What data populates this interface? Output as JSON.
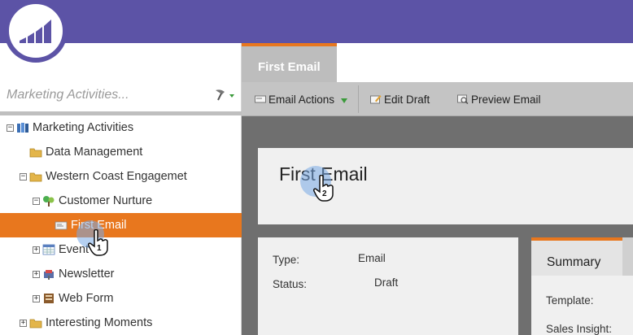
{
  "header": {
    "brand": "Marketo",
    "logo_icon": "marketo-logo-icon",
    "bar_color": "#5c53a6"
  },
  "search": {
    "placeholder": "Marketing Activities...",
    "filter_icon": "filter-icon"
  },
  "tree": [
    {
      "label": "Marketing Activities",
      "icon": "marketing-activities-icon",
      "expander": "−"
    },
    {
      "label": "Data Management",
      "icon": "folder-icon",
      "expander": ""
    },
    {
      "label": "Western Coast Engagemet",
      "icon": "folder-icon",
      "expander": "−"
    },
    {
      "label": "Customer Nurture",
      "icon": "program-icon",
      "expander": "−"
    },
    {
      "label": "First Email",
      "icon": "email-icon",
      "expander": "",
      "selected": true
    },
    {
      "label": "Event",
      "icon": "event-icon",
      "expander": "+"
    },
    {
      "label": "Newsletter",
      "icon": "newsletter-icon",
      "expander": "+"
    },
    {
      "label": "Web Form",
      "icon": "web-form-icon",
      "expander": "+"
    },
    {
      "label": "Interesting Moments",
      "icon": "folder-icon",
      "expander": "+"
    }
  ],
  "tabs": {
    "active_label": "First Email"
  },
  "toolbar": {
    "email_actions": "Email Actions",
    "edit_draft": "Edit Draft",
    "preview_email": "Preview Email"
  },
  "email": {
    "title": "First Email",
    "type_label": "Type:",
    "type_value": "Email",
    "status_label": "Status:",
    "status_value": "Draft"
  },
  "summary": {
    "tab_label": "Summary",
    "template_label": "Template:",
    "sales_insight_label": "Sales Insight:"
  },
  "annotations": {
    "click_1": "1",
    "click_2": "2"
  },
  "colors": {
    "accent": "#e8771e",
    "header": "#5c53a6"
  }
}
